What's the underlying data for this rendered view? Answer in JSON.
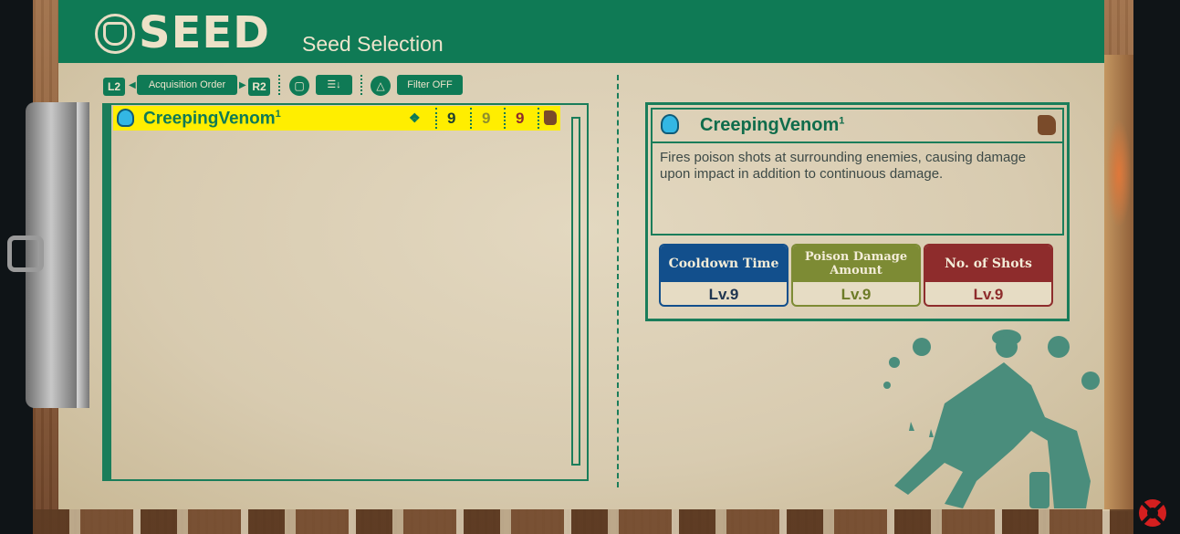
{
  "header": {
    "logo_text": "SEED",
    "subtitle": "Seed Selection"
  },
  "toolbar": {
    "l2": "L2",
    "sort_label": "Acquisition Order",
    "r2": "R2",
    "square": "▢",
    "sort_icon": "☰↓",
    "triangle": "△",
    "filter_label": "Filter  OFF"
  },
  "seed_list": [
    {
      "name": "CreepingVenom",
      "grade": "1",
      "stat_1": "9",
      "stat_2": "9",
      "stat_3": "9",
      "icon": "skull-icon",
      "type_icon": "watering-can-icon"
    }
  ],
  "detail": {
    "name": "CreepingVenom",
    "grade": "1",
    "description": "Fires poison shots at surrounding enemies, causing damage upon impact in addition to continuous damage.",
    "stats": [
      {
        "label": "Cooldown Time",
        "value": "Lv.9",
        "color": "#124f8c"
      },
      {
        "label": "Poison Damage Amount",
        "value": "Lv.9",
        "color": "#7d8b34"
      },
      {
        "label": "No. of Shots",
        "value": "Lv.9",
        "color": "#8e2c2c"
      }
    ]
  },
  "colors": {
    "accent_green": "#0f7a55",
    "highlight": "#ffee00",
    "paper": "#d8cbb0"
  }
}
